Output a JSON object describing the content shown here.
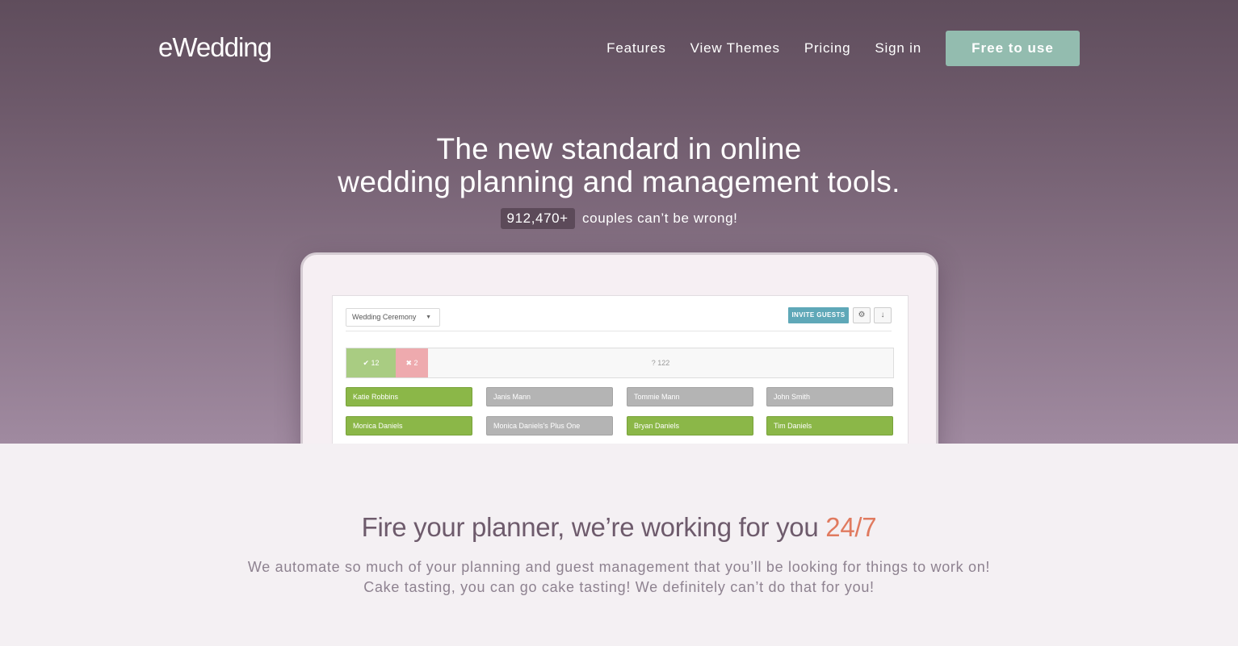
{
  "header": {
    "logo": "eWedding",
    "nav": [
      "Features",
      "View Themes",
      "Pricing",
      "Sign in"
    ],
    "cta": "Free to use"
  },
  "hero": {
    "title_line1": "The new standard in online",
    "title_line2": "wedding planning and management tools.",
    "count": "912,470+",
    "count_suffix": "couples can’t be wrong!"
  },
  "app": {
    "event_select": "Wedding Ceremony",
    "invite_label": "INVITE GUESTS",
    "settings_icon": "gear-icon",
    "download_icon": "download-icon",
    "rsvp": {
      "yes": "12",
      "no": "2",
      "pending": "122"
    },
    "guests": [
      {
        "name": "Katie Robbins",
        "status": "green"
      },
      {
        "name": "Janis Mann",
        "status": "gray"
      },
      {
        "name": "Tommie Mann",
        "status": "gray"
      },
      {
        "name": "John Smith",
        "status": "gray"
      },
      {
        "name": "Monica Daniels",
        "status": "green"
      },
      {
        "name": "Monica Daniels's Plus One",
        "status": "gray"
      },
      {
        "name": "Bryan Daniels",
        "status": "green"
      },
      {
        "name": "Tim Daniels",
        "status": "green"
      }
    ]
  },
  "feature": {
    "heading": "Fire your planner, we’re working for you ",
    "heading_accent": "24/7",
    "line1": "We automate so much of your planning and guest management that you’ll be looking for things to work on!",
    "line2": "Cake tasting, you can go cake tasting! We definitely can’t do that for you!"
  },
  "colors": {
    "accent": "#e07a5f",
    "cta": "#93bcaf",
    "guest_green": "#8bb748",
    "guest_gray": "#b4b4b4",
    "invite": "#5fa8b8"
  }
}
